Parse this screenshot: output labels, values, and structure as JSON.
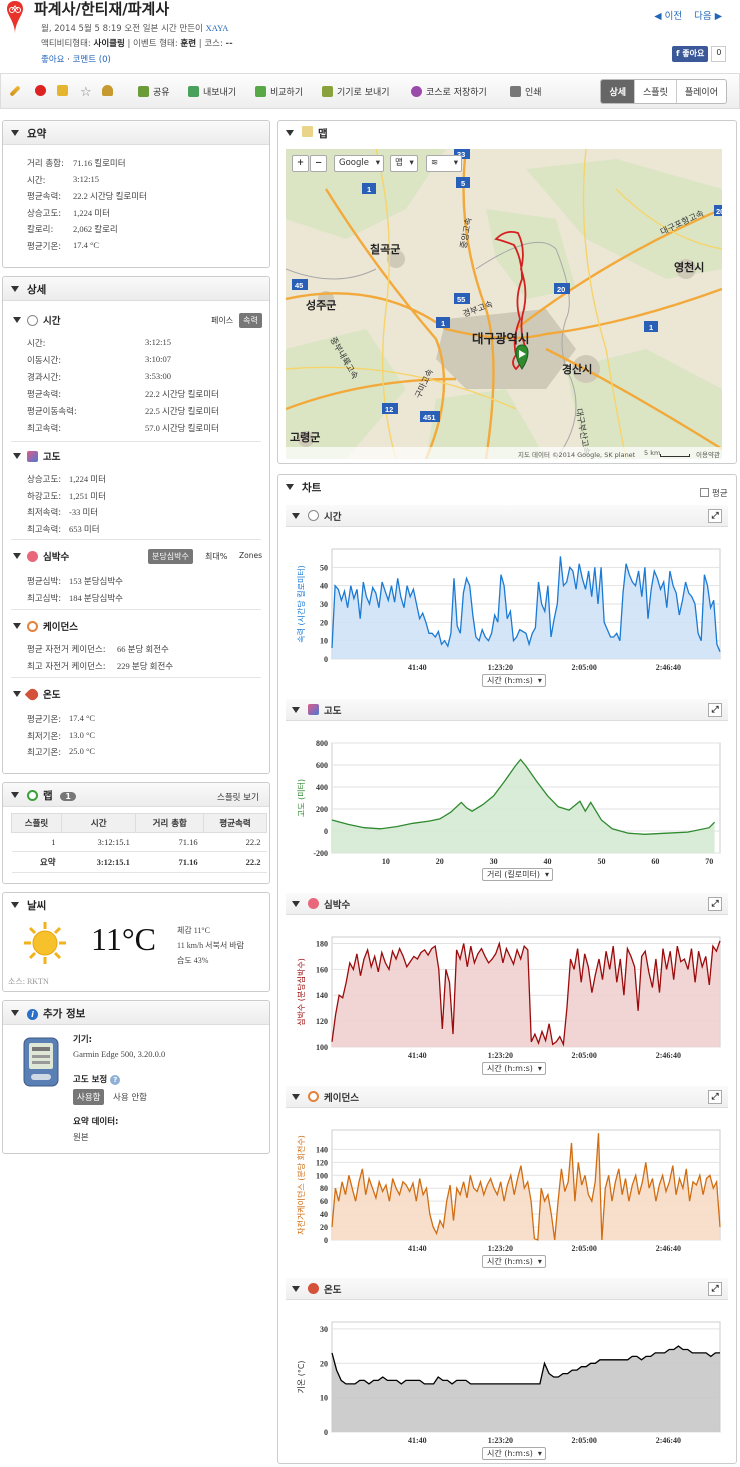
{
  "header": {
    "title": "파계사/한티재/파계사",
    "meta_line1": "월, 2014 5월 5 8:19 오전 일본 시간 만든이",
    "author": "XAYA",
    "activity_type_label": "액티비티형태:",
    "activity_type": "사이클링",
    "event_type_label": "| 이벤트 형태:",
    "event_type": "훈련",
    "course_label": "| 코스:",
    "course": "--",
    "like_link": "좋아요",
    "comment_link": "코멘트",
    "comment_count": "(0)",
    "prev": "이전",
    "next": "다음",
    "fb_like": "좋아요",
    "fb_count": "0"
  },
  "toolbar": {
    "share": "공유",
    "export": "내보내기",
    "compare": "비교하기",
    "send_device": "기기로 보내기",
    "save_course": "코스로 저장하기",
    "print": "인쇄",
    "view_details": "상세",
    "view_splits": "스플릿",
    "view_player": "플레이어"
  },
  "summary": {
    "title": "요약",
    "rows": [
      {
        "label": "거리 총합:",
        "value": "71.16 킬로미터"
      },
      {
        "label": "시간:",
        "value": "3:12:15"
      },
      {
        "label": "평균속력:",
        "value": "22.2 시간당 킬로미터"
      },
      {
        "label": "상승고도:",
        "value": "1,224 미터"
      },
      {
        "label": "칼로리:",
        "value": "2,062 칼로리"
      },
      {
        "label": "평균기온:",
        "value": "17.4 °C"
      }
    ]
  },
  "details": {
    "title": "상세",
    "time": {
      "title": "시간",
      "pace": "페이스",
      "speed": "속력",
      "rows": [
        {
          "label": "시간:",
          "value": "3:12:15"
        },
        {
          "label": "이동시간:",
          "value": "3:10:07"
        },
        {
          "label": "경과시간:",
          "value": "3:53:00"
        },
        {
          "label": "평균속력:",
          "value": "22.2 시간당 킬로미터"
        },
        {
          "label": "평균이동속력:",
          "value": "22.5 시간당 킬로미터"
        },
        {
          "label": "최고속력:",
          "value": "57.0 시간당 킬로미터"
        }
      ]
    },
    "elevation": {
      "title": "고도",
      "rows": [
        {
          "label": "상승고도:",
          "value": "1,224 미터"
        },
        {
          "label": "하강고도:",
          "value": "1,251 미터"
        },
        {
          "label": "최저속력:",
          "value": "-33 미터"
        },
        {
          "label": "최고속력:",
          "value": "653 미터"
        }
      ]
    },
    "heart": {
      "title": "심박수",
      "bpm": "분당심박수",
      "max_pct": "최대%",
      "zones": "Zones",
      "rows": [
        {
          "label": "평균심박:",
          "value": "153 분당심박수"
        },
        {
          "label": "최고심박:",
          "value": "184 분당심박수"
        }
      ]
    },
    "cadence": {
      "title": "케이던스",
      "rows": [
        {
          "label": "평균 자전거 케이던스:",
          "value": "66 분당 회전수"
        },
        {
          "label": "최고 자전거 케이던스:",
          "value": "229 분당 회전수"
        }
      ]
    },
    "temperature": {
      "title": "온도",
      "rows": [
        {
          "label": "평균기온:",
          "value": "17.4 °C"
        },
        {
          "label": "최저기온:",
          "value": "13.0 °C"
        },
        {
          "label": "최고기온:",
          "value": "25.0 °C"
        }
      ]
    }
  },
  "laps": {
    "title": "랩",
    "count": "1",
    "split_view": "스플릿 보기",
    "headers": [
      "스플릿",
      "시간",
      "거리 총합",
      "평균속력"
    ],
    "rows": [
      [
        "1",
        "3:12:15.1",
        "71.16",
        "22.2"
      ]
    ],
    "summary": [
      "요약",
      "3:12:15.1",
      "71.16",
      "22.2"
    ]
  },
  "weather": {
    "title": "날씨",
    "temp": "11°C",
    "feels": "체감 11°C",
    "wind": "11 km/h 서북서 바람",
    "humidity": "습도 43%",
    "source": "소스: RKTN"
  },
  "extra": {
    "title": "추가 정보",
    "device_label": "기기:",
    "device": "Garmin Edge 500, 3.20.0.0",
    "elev_corr_label": "고도 보정",
    "use": "사용함",
    "not_use": "사용 안함",
    "summary_data_label": "요약 데이터:",
    "summary_data": "원본"
  },
  "map": {
    "title": "맵",
    "btn_google": "Google",
    "btn_map": "맵",
    "labels": [
      "칠곡군",
      "영천시",
      "대구광역시",
      "경산시",
      "성주군",
      "고령군"
    ],
    "road_labels": [
      "중앙고속",
      "경부고속",
      "대구포항고속",
      "중부내륙고속",
      "대구부산고속",
      "구마고속"
    ],
    "shields": [
      "55",
      "5",
      "20",
      "1",
      "55",
      "20",
      "1",
      "45",
      "12",
      "451",
      "33"
    ],
    "copyright": "지도 데이터 ©2014 Google, SK planet",
    "scale": "5 km",
    "terms": "이용약관"
  },
  "charts_panel": {
    "title": "차트",
    "avg_label": "평균"
  },
  "charts": {
    "speed": {
      "title": "시간",
      "ylabel": "속력 (시간당 킬로미터)",
      "selector": "시간 (h:m:s)",
      "color": "#1a7ad4",
      "fill": "#cfe2f7",
      "ylim": [
        0,
        60
      ],
      "yticks": [
        0,
        10,
        20,
        30,
        40,
        50
      ],
      "xticks": [
        [
          "41:40",
          0.22
        ],
        [
          "1:23:20",
          0.434
        ],
        [
          "2:05:00",
          0.65
        ],
        [
          "2:46:40",
          0.867
        ]
      ],
      "values": [
        6,
        40,
        38,
        32,
        37,
        28,
        40,
        33,
        38,
        22,
        42,
        34,
        30,
        39,
        36,
        28,
        42,
        37,
        32,
        40,
        31,
        44,
        34,
        28,
        40,
        34,
        38,
        30,
        22,
        25,
        20,
        14,
        14,
        12,
        15,
        8,
        10,
        7,
        14,
        44,
        18,
        14,
        36,
        44,
        40,
        24,
        12,
        10,
        16,
        12,
        10,
        14,
        24,
        20,
        46,
        40,
        22,
        26,
        10,
        12,
        16,
        15,
        14,
        8,
        14,
        17,
        42,
        30,
        26,
        40,
        12,
        22,
        30,
        56,
        40,
        42,
        50,
        48,
        38,
        52,
        44,
        38,
        48,
        34,
        50,
        30,
        50,
        20,
        16,
        12,
        12,
        14,
        10,
        36,
        52,
        46,
        42,
        40,
        48,
        34,
        50,
        22,
        38,
        48,
        44,
        38,
        42,
        28,
        48,
        40,
        36,
        24,
        32,
        42,
        36,
        34,
        30,
        14,
        10,
        46,
        40,
        28,
        32,
        8,
        4
      ]
    },
    "elevation": {
      "title": "고도",
      "ylabel": "고도 (미터)",
      "selector": "거리 (킬로미터)",
      "color": "#2f8a2f",
      "fill": "#d4ead4",
      "ylim": [
        -200,
        800
      ],
      "yticks": [
        -200,
        0,
        200,
        400,
        600,
        800
      ],
      "xmax": 72,
      "xticks": [
        10,
        20,
        30,
        40,
        50,
        60,
        70
      ],
      "x": [
        0,
        3,
        6,
        9,
        12,
        15,
        18,
        20,
        22,
        24,
        25,
        26,
        28,
        30,
        32,
        34,
        35,
        36,
        38,
        40,
        42,
        44,
        46,
        47,
        48,
        50,
        52,
        55,
        58,
        62,
        66,
        70,
        71
      ],
      "values": [
        100,
        60,
        30,
        20,
        40,
        70,
        90,
        110,
        170,
        260,
        210,
        180,
        240,
        320,
        450,
        590,
        650,
        590,
        450,
        320,
        220,
        190,
        270,
        180,
        260,
        100,
        20,
        -20,
        -30,
        -20,
        -10,
        30,
        80
      ]
    },
    "heart": {
      "title": "심박수",
      "ylabel": "심박수 (분당심박수)",
      "selector": "시간 (h:m:s)",
      "color": "#9b0b0b",
      "fill": "#f0cfcf",
      "ylim": [
        100,
        185
      ],
      "yticks": [
        100,
        120,
        140,
        160,
        180
      ],
      "xticks": [
        [
          "41:40",
          0.22
        ],
        [
          "1:23:20",
          0.434
        ],
        [
          "2:05:00",
          0.65
        ],
        [
          "2:46:40",
          0.867
        ]
      ],
      "values": [
        104,
        125,
        140,
        138,
        150,
        165,
        160,
        172,
        155,
        168,
        175,
        162,
        170,
        158,
        173,
        165,
        160,
        174,
        168,
        176,
        170,
        162,
        166,
        170,
        168,
        173,
        175,
        171,
        176,
        178,
        160,
        114,
        160,
        150,
        110,
        175,
        168,
        180,
        162,
        178,
        165,
        172,
        176,
        170,
        165,
        168,
        172,
        180,
        165,
        176,
        170,
        164,
        175,
        168,
        178,
        175,
        104,
        110,
        103,
        112,
        105,
        118,
        102,
        104,
        108,
        102,
        130,
        168,
        160,
        176,
        150,
        172,
        162,
        142,
        156,
        168,
        152,
        174,
        160,
        178,
        150,
        168,
        140,
        176,
        170,
        162,
        128,
        170,
        174,
        158,
        146,
        168,
        142,
        176,
        160,
        174,
        152,
        178,
        166,
        168,
        160,
        176,
        150,
        174,
        162,
        170,
        148,
        178,
        174,
        182
      ]
    },
    "cadence": {
      "title": "케이던스",
      "ylabel": "자전거케이던스 (분당 회전수)",
      "selector": "시간 (h:m:s)",
      "color": "#d06d12",
      "fill": "#f7dcc5",
      "ylim": [
        0,
        170
      ],
      "yticks": [
        0,
        20,
        40,
        60,
        80,
        100,
        120,
        140
      ],
      "xticks": [
        [
          "41:40",
          0.22
        ],
        [
          "1:23:20",
          0.434
        ],
        [
          "2:05:00",
          0.65
        ],
        [
          "2:46:40",
          0.867
        ]
      ],
      "values": [
        20,
        80,
        60,
        90,
        70,
        100,
        80,
        60,
        90,
        110,
        70,
        95,
        80,
        65,
        90,
        75,
        85,
        60,
        95,
        80,
        70,
        90,
        85,
        75,
        88,
        60,
        95,
        70,
        80,
        40,
        20,
        10,
        30,
        20,
        60,
        85,
        30,
        80,
        70,
        90,
        65,
        100,
        80,
        75,
        90,
        70,
        85,
        95,
        80,
        70,
        90,
        60,
        85,
        100,
        70,
        95,
        115,
        80,
        90,
        60,
        2,
        0,
        80,
        60,
        70,
        40,
        0,
        60,
        110,
        75,
        90,
        150,
        60,
        120,
        85,
        100,
        70,
        60,
        90,
        165,
        0,
        80,
        100,
        60,
        90,
        110,
        70,
        95,
        60,
        85,
        100,
        70,
        90,
        120,
        80,
        95,
        60,
        85,
        100,
        75,
        90,
        115,
        70,
        95,
        80,
        110,
        60,
        90,
        85,
        100,
        70,
        95,
        100,
        80,
        90,
        20
      ]
    },
    "temperature": {
      "title": "온도",
      "ylabel": "기온 (°C)",
      "selector": "시간 (h:m:s)",
      "color": "#000000",
      "fill": "#c8c8c8",
      "ylim": [
        0,
        32
      ],
      "yticks": [
        0,
        10,
        20,
        30
      ],
      "xticks": [
        [
          "41:40",
          0.22
        ],
        [
          "1:23:20",
          0.434
        ],
        [
          "2:05:00",
          0.65
        ],
        [
          "2:46:40",
          0.867
        ]
      ],
      "values": [
        23,
        18,
        15,
        14,
        14,
        14,
        15,
        15,
        14,
        15,
        15,
        16,
        15,
        15,
        15,
        14,
        15,
        15,
        15,
        15,
        14,
        14,
        14,
        16,
        15,
        15,
        14,
        15,
        15,
        15,
        14,
        14,
        14,
        14,
        14,
        14,
        14,
        14,
        14,
        14,
        14,
        14,
        14,
        14,
        14,
        14,
        20,
        17,
        16,
        16,
        17,
        17,
        18,
        18,
        19,
        19,
        20,
        20,
        21,
        21,
        21,
        21,
        21,
        21,
        21,
        22,
        22,
        21,
        22,
        22,
        23,
        23,
        23,
        24,
        24,
        25,
        24,
        24,
        23,
        23,
        23,
        23,
        22,
        23,
        23
      ]
    }
  }
}
